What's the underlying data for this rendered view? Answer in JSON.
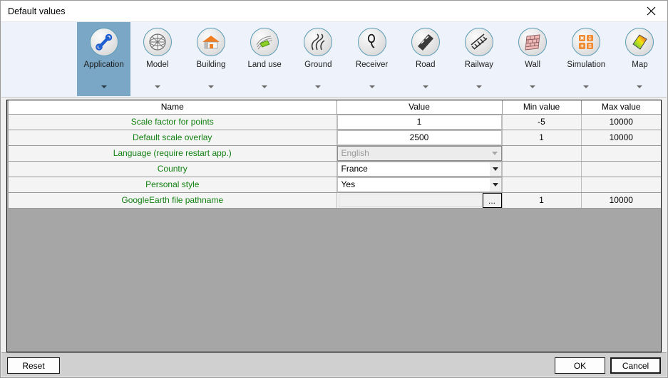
{
  "window": {
    "title": "Default values",
    "close_icon": "close-icon"
  },
  "ribbon": {
    "items": [
      {
        "label": "Application",
        "icon": "wrench-icon",
        "active": true
      },
      {
        "label": "Model",
        "icon": "mesh-globe-icon",
        "active": false
      },
      {
        "label": "Building",
        "icon": "house-icon",
        "active": false
      },
      {
        "label": "Land use",
        "icon": "land-patch-icon",
        "active": false
      },
      {
        "label": "Ground",
        "icon": "contour-icon",
        "active": false
      },
      {
        "label": "Receiver",
        "icon": "receiver-pin-icon",
        "active": false
      },
      {
        "label": "Road",
        "icon": "road-icon",
        "active": false
      },
      {
        "label": "Railway",
        "icon": "railway-icon",
        "active": false
      },
      {
        "label": "Wall",
        "icon": "brick-wall-icon",
        "active": false
      },
      {
        "label": "Simulation",
        "icon": "calculator-icon",
        "active": false
      },
      {
        "label": "Map",
        "icon": "rainbow-map-icon",
        "active": false
      }
    ]
  },
  "grid": {
    "columns": [
      "Name",
      "Value",
      "Min value",
      "Max value"
    ],
    "rows": [
      {
        "name": "Scale factor for points",
        "value": "1",
        "min": "-5",
        "max": "10000",
        "kind": "edit"
      },
      {
        "name": "Default scale overlay",
        "value": "2500",
        "min": "1",
        "max": "10000",
        "kind": "edit"
      },
      {
        "name": "Language (require restart app.)",
        "value": "English",
        "min": "",
        "max": "",
        "kind": "combo-disabled"
      },
      {
        "name": "Country",
        "value": "France",
        "min": "",
        "max": "",
        "kind": "combo"
      },
      {
        "name": "Personal style",
        "value": "Yes",
        "min": "",
        "max": "",
        "kind": "combo"
      },
      {
        "name": "GoogleEarth file pathname",
        "value": "",
        "min": "1",
        "max": "10000",
        "kind": "browse"
      }
    ],
    "browse_button_label": "..."
  },
  "footer": {
    "reset_label": "Reset",
    "ok_label": "OK",
    "cancel_label": "Cancel"
  },
  "colors": {
    "name_text": "#128012",
    "ribbon_bg": "#eef2fb",
    "active_tab": "#7ba7c7",
    "grid_empty": "#a6a6a6"
  }
}
